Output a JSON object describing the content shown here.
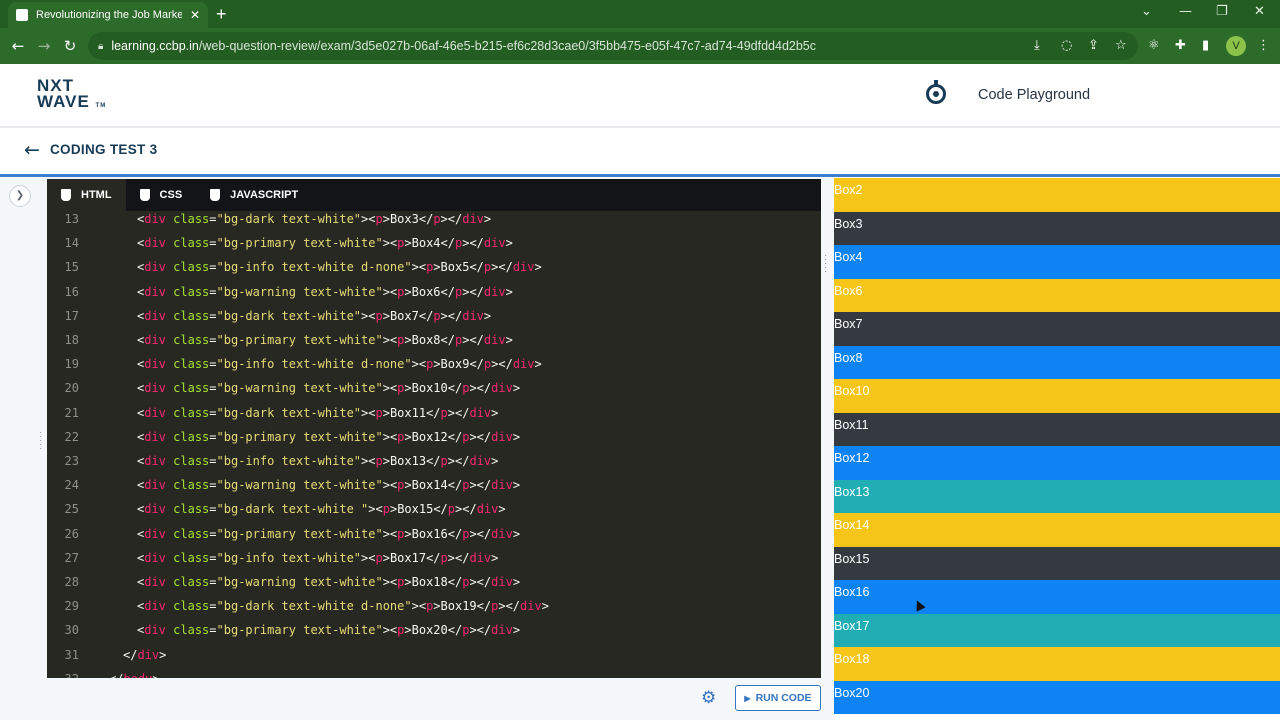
{
  "browser": {
    "tab_title": "Revolutionizing the Job Market |",
    "url_host": "learning.ccbp.in",
    "url_path": "/web-question-review/exam/3d5e027b-06af-46e5-b215-ef6c28d3cae0/3f5bb475-e05f-47c7-ad74-49dfdd4d2b5c",
    "avatar_letter": "V"
  },
  "header": {
    "logo_line1": "NXT",
    "logo_line2": "WAVE",
    "logo_tm": "TM",
    "playground_label": "Code Playground"
  },
  "subheader": {
    "title": "CODING TEST 3"
  },
  "editor": {
    "tabs": [
      {
        "label": "HTML",
        "icon": "html5-icon"
      },
      {
        "label": "CSS",
        "icon": "css3-icon"
      },
      {
        "label": "JAVASCRIPT",
        "icon": "js-file-icon"
      }
    ],
    "lines": [
      {
        "n": "13",
        "indent": "  ",
        "cls": "bg-dark text-white",
        "text": "Box3"
      },
      {
        "n": "14",
        "indent": "  ",
        "cls": "bg-primary text-white",
        "text": "Box4"
      },
      {
        "n": "15",
        "indent": "  ",
        "cls": "bg-info text-white d-none",
        "text": "Box5"
      },
      {
        "n": "16",
        "indent": "  ",
        "cls": "bg-warning text-white",
        "text": "Box6"
      },
      {
        "n": "17",
        "indent": "  ",
        "cls": "bg-dark text-white",
        "text": "Box7"
      },
      {
        "n": "18",
        "indent": "  ",
        "cls": "bg-primary text-white",
        "text": "Box8"
      },
      {
        "n": "19",
        "indent": "  ",
        "cls": "bg-info text-white d-none",
        "text": "Box9"
      },
      {
        "n": "20",
        "indent": "  ",
        "cls": "bg-warning text-white",
        "text": "Box10"
      },
      {
        "n": "21",
        "indent": "  ",
        "cls": "bg-dark text-white",
        "text": "Box11"
      },
      {
        "n": "22",
        "indent": "  ",
        "cls": "bg-primary text-white",
        "text": "Box12"
      },
      {
        "n": "23",
        "indent": "  ",
        "cls": "bg-info text-white",
        "text": "Box13"
      },
      {
        "n": "24",
        "indent": "  ",
        "cls": "bg-warning text-white",
        "text": "Box14"
      },
      {
        "n": "25",
        "indent": "  ",
        "cls": "bg-dark text-white ",
        "text": "Box15"
      },
      {
        "n": "26",
        "indent": "  ",
        "cls": "bg-primary text-white",
        "text": "Box16"
      },
      {
        "n": "27",
        "indent": "  ",
        "cls": "bg-info text-white",
        "text": "Box17"
      },
      {
        "n": "28",
        "indent": "  ",
        "cls": "bg-warning text-white",
        "text": "Box18"
      },
      {
        "n": "29",
        "indent": "  ",
        "cls": "bg-dark text-white d-none",
        "text": "Box19"
      },
      {
        "n": "30",
        "indent": "  ",
        "cls": "bg-primary text-white",
        "text": "Box20"
      }
    ],
    "closing_lines": [
      {
        "n": "31",
        "tag": "div"
      },
      {
        "n": "32",
        "tag": "body"
      }
    ]
  },
  "actions": {
    "run_label": "RUN CODE"
  },
  "preview": {
    "boxes": [
      {
        "label": "Box2",
        "color": "#f5c518"
      },
      {
        "label": "Box3",
        "color": "#343a40"
      },
      {
        "label": "Box4",
        "color": "#0d83f4"
      },
      {
        "label": "Box6",
        "color": "#f5c518"
      },
      {
        "label": "Box7",
        "color": "#343a40"
      },
      {
        "label": "Box8",
        "color": "#0d83f4"
      },
      {
        "label": "Box10",
        "color": "#f5c518"
      },
      {
        "label": "Box11",
        "color": "#343a40"
      },
      {
        "label": "Box12",
        "color": "#0d83f4"
      },
      {
        "label": "Box13",
        "color": "#20aeb4"
      },
      {
        "label": "Box14",
        "color": "#f5c518"
      },
      {
        "label": "Box15",
        "color": "#343a40"
      },
      {
        "label": "Box16",
        "color": "#0d83f4"
      },
      {
        "label": "Box17",
        "color": "#20aeb4"
      },
      {
        "label": "Box18",
        "color": "#f5c518"
      },
      {
        "label": "Box20",
        "color": "#0d83f4"
      }
    ]
  }
}
